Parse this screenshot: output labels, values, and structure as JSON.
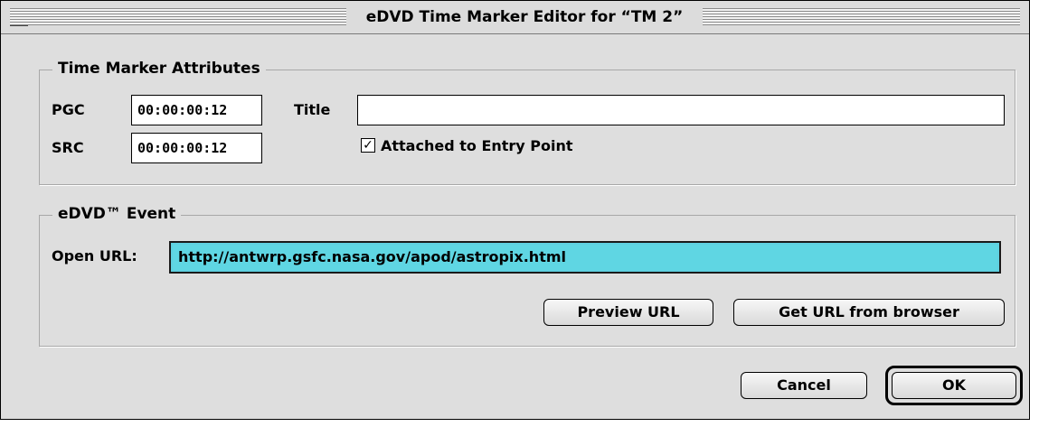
{
  "window": {
    "title": "eDVD Time Marker Editor for “TM 2”"
  },
  "attributes": {
    "group_label": "Time Marker Attributes",
    "pgc_label": "PGC",
    "pgc_value": "00:00:00:12",
    "src_label": "SRC",
    "src_value": "00:00:00:12",
    "title_label": "Title",
    "title_value": "",
    "attached_label": "Attached to Entry Point",
    "attached_checked": true
  },
  "event": {
    "group_label": "eDVD™ Event",
    "open_url_label": "Open URL:",
    "url_value": "http://antwrp.gsfc.nasa.gov/apod/astropix.html",
    "preview_label": "Preview URL",
    "get_url_label": "Get URL from browser"
  },
  "footer": {
    "cancel_label": "Cancel",
    "ok_label": "OK"
  }
}
